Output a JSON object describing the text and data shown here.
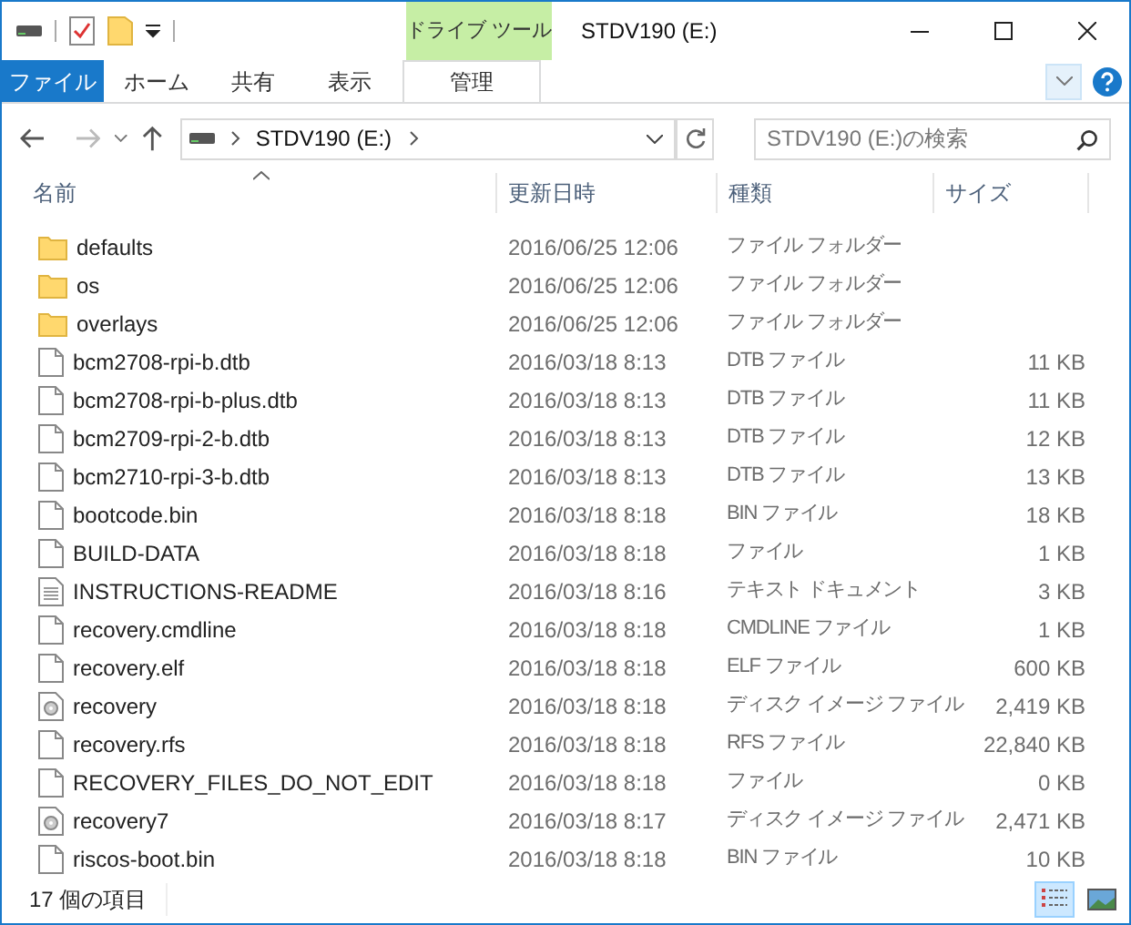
{
  "window": {
    "title": "STDV190 (E:)",
    "context_label": "ドライブ ツール"
  },
  "ribbon_tabs": [
    {
      "label": "ファイル",
      "kind": "file"
    },
    {
      "label": "ホーム",
      "kind": "normal"
    },
    {
      "label": "共有",
      "kind": "normal"
    },
    {
      "label": "表示",
      "kind": "normal"
    },
    {
      "label": "管理",
      "kind": "contextual"
    }
  ],
  "address": {
    "segments": [
      "STDV190 (E:)"
    ]
  },
  "search": {
    "placeholder": "STDV190 (E:)の検索"
  },
  "columns": [
    "名前",
    "更新日時",
    "種類",
    "サイズ"
  ],
  "files": [
    {
      "name": "defaults",
      "date": "2016/06/25 12:06",
      "type": "ファイル フォルダー",
      "kind": "folder"
    },
    {
      "name": "os",
      "date": "2016/06/25 12:06",
      "type": "ファイル フォルダー",
      "kind": "folder"
    },
    {
      "name": "overlays",
      "date": "2016/06/25 12:06",
      "type": "ファイル フォルダー",
      "kind": "folder"
    },
    {
      "name": "bcm2708-rpi-b.dtb",
      "date": "2016/03/18 8:13",
      "type": "DTB ファイル",
      "size": "11 KB",
      "kind": "file"
    },
    {
      "name": "bcm2708-rpi-b-plus.dtb",
      "date": "2016/03/18 8:13",
      "type": "DTB ファイル",
      "size": "11 KB",
      "kind": "file"
    },
    {
      "name": "bcm2709-rpi-2-b.dtb",
      "date": "2016/03/18 8:13",
      "type": "DTB ファイル",
      "size": "12 KB",
      "kind": "file"
    },
    {
      "name": "bcm2710-rpi-3-b.dtb",
      "date": "2016/03/18 8:13",
      "type": "DTB ファイル",
      "size": "13 KB",
      "kind": "file"
    },
    {
      "name": "bootcode.bin",
      "date": "2016/03/18 8:18",
      "type": "BIN ファイル",
      "size": "18 KB",
      "kind": "file"
    },
    {
      "name": "BUILD-DATA",
      "date": "2016/03/18 8:18",
      "type": "ファイル",
      "size": "1 KB",
      "kind": "file"
    },
    {
      "name": "INSTRUCTIONS-README",
      "date": "2016/03/18 8:16",
      "type": "テキスト ドキュメント",
      "size": "3 KB",
      "kind": "text"
    },
    {
      "name": "recovery.cmdline",
      "date": "2016/03/18 8:18",
      "type": "CMDLINE ファイル",
      "size": "1 KB",
      "kind": "file"
    },
    {
      "name": "recovery.elf",
      "date": "2016/03/18 8:18",
      "type": "ELF ファイル",
      "size": "600 KB",
      "kind": "file"
    },
    {
      "name": "recovery",
      "date": "2016/03/18 8:18",
      "type": "ディスク イメージ ファイル",
      "size": "2,419 KB",
      "kind": "disc"
    },
    {
      "name": "recovery.rfs",
      "date": "2016/03/18 8:18",
      "type": "RFS ファイル",
      "size": "22,840 KB",
      "kind": "file"
    },
    {
      "name": "RECOVERY_FILES_DO_NOT_EDIT",
      "date": "2016/03/18 8:18",
      "type": "ファイル",
      "size": "0 KB",
      "kind": "file"
    },
    {
      "name": "recovery7",
      "date": "2016/03/18 8:17",
      "type": "ディスク イメージ ファイル",
      "size": "2,471 KB",
      "kind": "disc"
    },
    {
      "name": "riscos-boot.bin",
      "date": "2016/03/18 8:18",
      "type": "BIN ファイル",
      "size": "10 KB",
      "kind": "file"
    }
  ],
  "status_bar": {
    "item_count": "17 個の項目"
  },
  "view_buttons": [
    {
      "kind": "details",
      "selected": true
    },
    {
      "kind": "large-icons",
      "selected": false
    }
  ]
}
